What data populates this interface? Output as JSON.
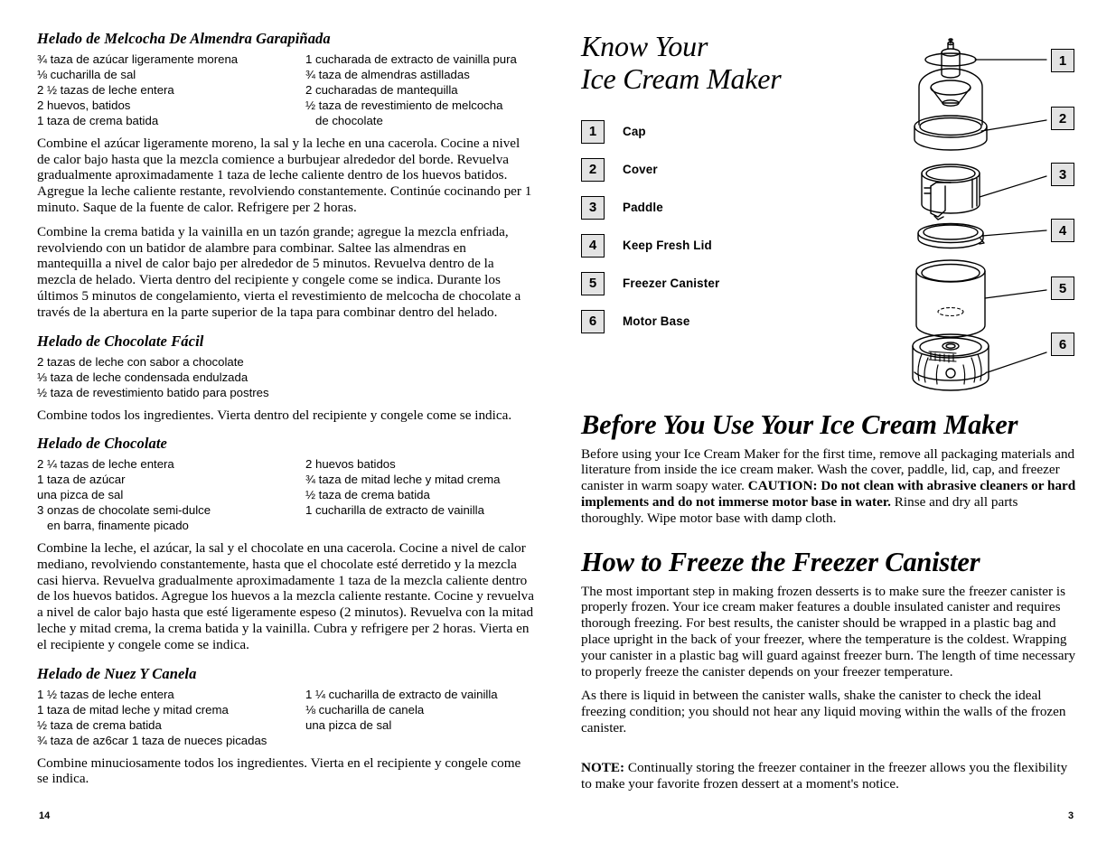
{
  "left_page": {
    "folio": "14",
    "recipes": [
      {
        "title": "Helado de Melcocha De Almendra Garapiñada",
        "ingredients_left": [
          "¾ taza de azúcar ligeramente morena",
          "⅛ cucharilla de sal",
          "2 ½ tazas de leche entera",
          "2 huevos, batidos",
          "1 taza de crema batida"
        ],
        "ingredients_right": [
          "1 cucharada de extracto de vainilla pura",
          "¾ taza de almendras astilladas",
          "2 cucharadas de mantequilla",
          "½ taza de revestimiento de melcocha",
          "   de chocolate"
        ],
        "paragraphs": [
          "Combine el azúcar ligeramente moreno, la sal y la leche en una cacerola. Cocine a nivel de calor bajo hasta que la mezcla comience a burbujear alrededor del borde. Revuelva gradualmente aproximadamente 1 taza de leche caliente dentro de los huevos batidos. Agregue la leche caliente restante, revolviendo constantemente. Continúe cocinando per 1 minuto. Saque de la fuente de calor. Refrigere per 2 horas.",
          "Combine la crema batida y la vainilla en un tazón grande; agregue la mezcla enfriada, revolviendo con un batidor de alambre para combinar. Saltee las almendras en mantequilla a nivel de calor bajo per alrededor de 5 minutos. Revuelva dentro de la mezcla de helado. Vierta dentro del recipiente y congele come se indica. Durante los últimos 5 minutos de congelamiento, vierta el revestimiento de melcocha de chocolate a través de la abertura en la parte superior de la tapa para combinar dentro del helado."
        ]
      },
      {
        "title": "Helado de Chocolate Fácil",
        "ingredients_left": [
          "2 tazas de leche con sabor a chocolate",
          "⅓ taza de leche condensada endulzada",
          "½ taza de revestimiento batido para postres"
        ],
        "ingredients_right": [],
        "paragraphs": [
          "Combine todos los ingredientes. Vierta dentro del recipiente y congele come se indica."
        ]
      },
      {
        "title": "Helado de Chocolate",
        "ingredients_left": [
          "2 ¼ tazas de leche entera",
          "1 taza de azúcar",
          "una pizca de sal",
          "3 onzas de chocolate semi-dulce",
          "   en barra, finamente picado"
        ],
        "ingredients_right": [
          "2 huevos batidos",
          "¾ taza de mitad leche y mitad crema",
          "½ taza de crema batida",
          "1 cucharilla de extracto de vainilla"
        ],
        "paragraphs": [
          "Combine la leche, el azúcar, la sal y el chocolate en una cacerola. Cocine a nivel de calor mediano, revolviendo constantemente, hasta que el chocolate esté derretido y la mezcla casi hierva. Revuelva gradualmente aproximadamente 1 taza de la mezcla caliente dentro de los huevos batidos. Agregue los huevos a la mezcla caliente restante. Cocine y revuelva a nivel de calor bajo hasta que esté ligeramente espeso (2 minutos). Revuelva con la mitad leche y mitad crema, la crema batida y la vainilla. Cubra y refrigere per 2 horas. Vierta en el recipiente y congele come se indica."
        ]
      },
      {
        "title": "Helado de Nuez Y Canela",
        "ingredients_left": [
          "1 ½ tazas de leche entera",
          "1 taza de mitad leche y mitad crema",
          "½ taza de crema batida",
          "¾ taza de az6car 1 taza de nueces picadas"
        ],
        "ingredients_right": [
          "1 ¼ cucharilla de extracto de vainilla",
          "⅛ cucharilla de canela",
          "una pizca de sal"
        ],
        "paragraphs": [
          "Combine minuciosamente todos los ingredientes. Vierta en el recipiente y congele come se indica."
        ]
      }
    ]
  },
  "right_page": {
    "folio": "3",
    "know_your": {
      "title_line1": "Know Your",
      "title_line2": "Ice Cream Maker",
      "parts": [
        {
          "number": "1",
          "label": "Cap"
        },
        {
          "number": "2",
          "label": "Cover"
        },
        {
          "number": "3",
          "label": "Paddle"
        },
        {
          "number": "4",
          "label": "Keep Fresh Lid"
        },
        {
          "number": "5",
          "label": "Freezer Canister"
        },
        {
          "number": "6",
          "label": "Motor Base"
        }
      ],
      "callouts": [
        "1",
        "2",
        "3",
        "4",
        "5",
        "6"
      ]
    },
    "before_use": {
      "heading": "Before You Use Your Ice Cream Maker",
      "text_a": "Before using your Ice Cream Maker for the first time, remove all packaging materials and literature from inside the ice cream maker. Wash the cover, paddle, lid, cap, and freezer canister in warm soapy water. ",
      "caution": "CAUTION: Do not clean with abrasive cleaners or hard implements and do not immerse motor base in water.",
      "text_b": " Rinse and dry all parts thoroughly. Wipe motor base with damp cloth."
    },
    "how_to_freeze": {
      "heading": "How to Freeze the Freezer Canister",
      "paragraph1": "The most important step in making frozen desserts is to make sure the freezer canister is properly frozen. Your ice cream maker features a double insulated canister and requires thorough freezing. For best results, the canister should be wrapped in a plastic bag and place upright in the back of your freezer, where the temperature is the coldest. Wrapping your canister in a plastic bag will guard against freezer burn. The length of time necessary to properly freeze the canister depends on your freezer temperature.",
      "paragraph2": "As there is liquid in between the canister walls, shake the canister to check the ideal freezing condition; you should not hear any liquid moving within the walls of the frozen canister.",
      "note_label": "NOTE:",
      "note_text": " Continually storing the freezer container in the freezer allows you the flexibility to make your favorite frozen dessert at a moment's notice."
    }
  },
  "colors": {
    "ink": "#000000",
    "paper": "#ffffff",
    "box_fill": "#e3e3e3"
  }
}
